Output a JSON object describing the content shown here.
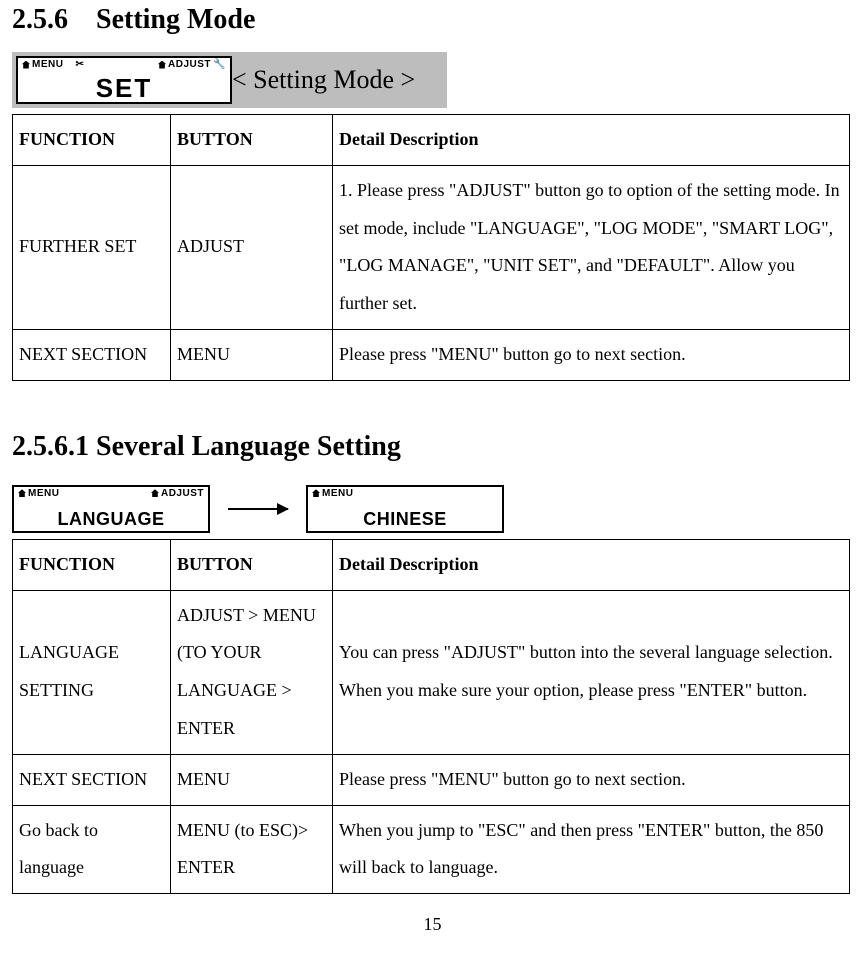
{
  "section256": {
    "number": "2.5.6",
    "title": "Setting Mode",
    "lcd_caption": "< Setting Mode >",
    "lcd": {
      "menu_label": "MENU",
      "adjust_label": "ADJUST",
      "main_text": "SET"
    },
    "table": {
      "headers": {
        "c1": "FUNCTION",
        "c2": "BUTTON",
        "c3": "Detail Description"
      },
      "rows": [
        {
          "func": "FURTHER SET",
          "button": "ADJUST",
          "detail": "1. Please press \"ADJUST\" button go to option of the setting mode. In set mode, include \"LANGUAGE\", \"LOG MODE\", \"SMART LOG\", \"LOG MANAGE\", \"UNIT SET\", and \"DEFAULT\". Allow you further set."
        },
        {
          "func": "NEXT SECTION",
          "button": "MENU",
          "detail": "Please press \"MENU\" button go to next section."
        }
      ]
    }
  },
  "section2561": {
    "title": "2.5.6.1 Several Language Setting",
    "lcd_left": {
      "menu_label": "MENU",
      "adjust_label": "ADJUST",
      "main_text": "LANGUAGE"
    },
    "lcd_right": {
      "menu_label": "MENU",
      "main_text": "CHINESE"
    },
    "table": {
      "headers": {
        "c1": "FUNCTION",
        "c2": "BUTTON",
        "c3": "Detail Description"
      },
      "rows": [
        {
          "func": "LANGUAGE SETTING",
          "button": "ADJUST > MENU (TO YOUR LANGUAGE > ENTER",
          "detail": "You can press \"ADJUST\" button into the several language selection. When you make sure your option, please press \"ENTER\" button."
        },
        {
          "func": "NEXT SECTION",
          "button": "MENU",
          "detail": "Please press \"MENU\" button go to next section."
        },
        {
          "func": "Go back to language",
          "button": "MENU (to ESC)> ENTER",
          "detail": "When you jump to \"ESC\" and then press \"ENTER\" button, the 850 will back to language."
        }
      ]
    }
  },
  "page_number": "15"
}
